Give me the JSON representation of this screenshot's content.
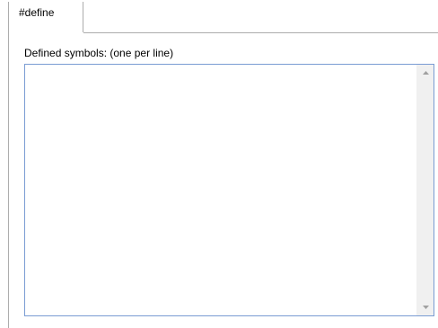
{
  "tabs": [
    {
      "label": "#define",
      "selected": true
    }
  ],
  "defines": {
    "label": "Defined symbols:  (one per line)",
    "value": "",
    "scrollbar_color": "#f0f0f0",
    "border_color": "#7a9cd3",
    "scroll_up_icon": "chevron-up-icon",
    "scroll_down_icon": "chevron-down-icon"
  }
}
